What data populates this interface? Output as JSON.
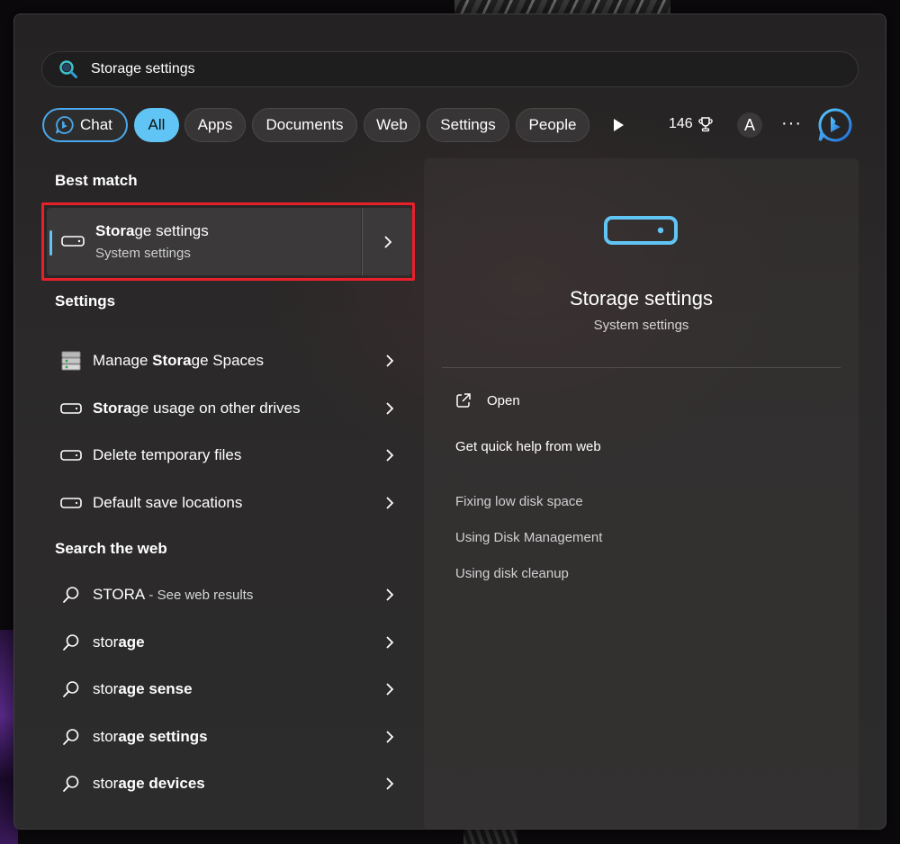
{
  "search": {
    "query": "Storage settings"
  },
  "filters": {
    "chat": "Chat",
    "all": "All",
    "apps": "Apps",
    "documents": "Documents",
    "web": "Web",
    "settings": "Settings",
    "people": "People",
    "points": "146",
    "avatar_initial": "A",
    "more": "···"
  },
  "best_match": {
    "heading": "Best match",
    "title_bold": "Stora",
    "title_rest": "ge settings",
    "subtitle": "System settings"
  },
  "settings_section": {
    "heading": "Settings",
    "items": [
      {
        "pre": "Manage ",
        "bold": "Stora",
        "post": "ge Spaces",
        "icon": "storage-spaces-icon"
      },
      {
        "pre": "",
        "bold": "Stora",
        "post": "ge usage on other drives",
        "icon": "drive-icon"
      },
      {
        "pre": "Delete temporary files",
        "bold": "",
        "post": "",
        "icon": "drive-icon"
      },
      {
        "pre": "Default save locations",
        "bold": "",
        "post": "",
        "icon": "drive-icon"
      }
    ]
  },
  "web_section": {
    "heading": "Search the web",
    "items": [
      {
        "pre": "STORA",
        "bold": "",
        "post": "",
        "suffix": " - See web results"
      },
      {
        "pre": "stor",
        "bold": "age",
        "post": ""
      },
      {
        "pre": "stor",
        "bold": "age sense",
        "post": ""
      },
      {
        "pre": "stor",
        "bold": "age settings",
        "post": ""
      },
      {
        "pre": "stor",
        "bold": "age devices",
        "post": ""
      }
    ]
  },
  "preview": {
    "title": "Storage settings",
    "subtitle": "System settings",
    "open_label": "Open",
    "help_heading": "Get quick help from web",
    "help_links": [
      "Fixing low disk space",
      "Using Disk Management",
      "Using disk cleanup"
    ]
  },
  "colors": {
    "accent": "#60c5f4",
    "highlight_border": "#e8202a",
    "panel_bg": "#2a2828"
  }
}
